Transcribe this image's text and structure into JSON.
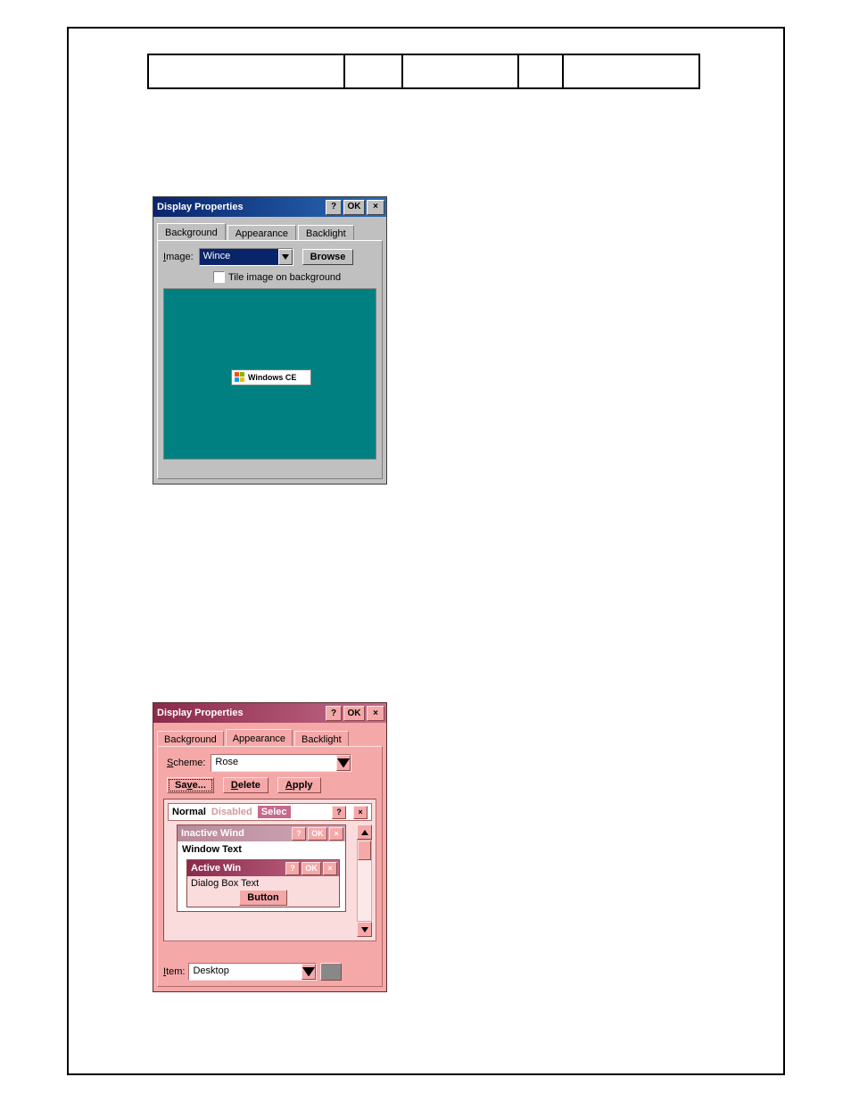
{
  "dialog1": {
    "title": "Display Properties",
    "buttons": {
      "help": "?",
      "ok": "OK",
      "close": "×"
    },
    "tabs": [
      "Background",
      "Appearance",
      "Backlight"
    ],
    "activeTab": 0,
    "image": {
      "label_prefix": "I",
      "label_rest": "mage:",
      "value": "Wince",
      "browse": "Browse"
    },
    "tile": {
      "label": "Tile image on background",
      "checked": false
    },
    "preview": {
      "badge": "Windows CE"
    }
  },
  "dialog2": {
    "title": "Display Properties",
    "buttons": {
      "help": "?",
      "ok": "OK",
      "close": "×"
    },
    "tabs": [
      "Background",
      "Appearance",
      "Backlight"
    ],
    "activeTab": 1,
    "scheme": {
      "label_prefix": "S",
      "label_rest": "cheme:",
      "value": "Rose"
    },
    "actions": {
      "save_prefix": "Sa",
      "save_und": "v",
      "save_rest": "e...",
      "delete_und": "D",
      "delete_rest": "elete",
      "apply_und": "A",
      "apply_rest": "pply"
    },
    "preview": {
      "menu": {
        "normal": "Normal",
        "disabled": "Disabled",
        "selected": "Selec"
      },
      "menuButtons": {
        "help": "?",
        "close": "×"
      },
      "inactive": {
        "title": "Inactive Wind",
        "help": "?",
        "ok": "OK",
        "close": "×"
      },
      "windowText": "Window Text",
      "active": {
        "title": "Active Win",
        "help": "?",
        "ok": "OK",
        "close": "×",
        "dialogText": "Dialog Box Text",
        "button": "Button"
      }
    },
    "item": {
      "label_und": "I",
      "label_rest": "tem:",
      "value": "Desktop"
    }
  }
}
